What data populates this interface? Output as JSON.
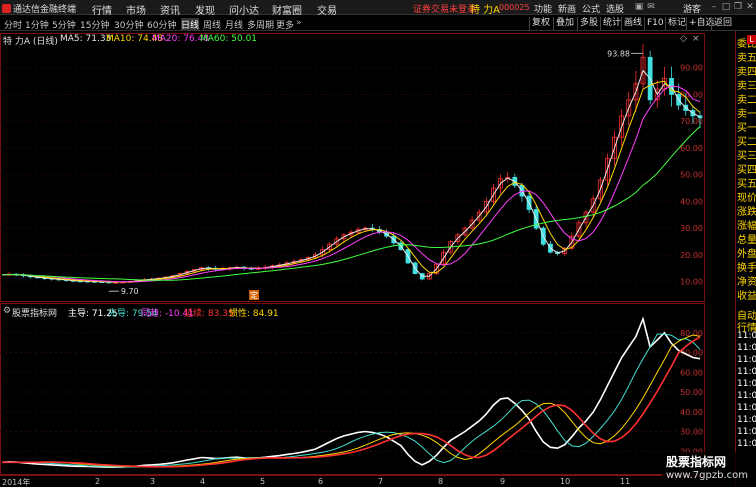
{
  "titlebar": {
    "app_name": "通达信金融终端",
    "menus": [
      "行情",
      "市场",
      "资讯",
      "发现",
      "问小达",
      "财富圈",
      "交易"
    ],
    "not_logged": "证券交易未登录",
    "stock_name": "特 力A",
    "stock_sub": "000025",
    "right_menus": [
      "功能",
      "新画",
      "公式",
      "选股",
      "游客"
    ]
  },
  "toolbar": {
    "periods": [
      "分时",
      "1分钟",
      "5分钟",
      "15分钟",
      "30分钟",
      "60分钟",
      "日线",
      "周线",
      "月线",
      "多周期",
      "更多"
    ],
    "selected_period": "日线",
    "right_buttons": [
      "复权",
      "叠加",
      "多股",
      "统计",
      "画线",
      "F10",
      "标记",
      "+自选",
      "返回"
    ]
  },
  "ma_legend": {
    "title": "特 力A (日线)",
    "items": [
      {
        "label": "MA5: 71.33",
        "color": "#e8e8e8"
      },
      {
        "label": "MA10: 74.48",
        "color": "#ffd700"
      },
      {
        "label": "MA20: 76.48",
        "color": "#ff40ff"
      },
      {
        "label": "MA60: 50.01",
        "color": "#40ff40"
      }
    ]
  },
  "main_chart": {
    "y_ticks": [
      "90.00",
      "80.00",
      "70.00",
      "60.00",
      "50.00",
      "40.00",
      "30.00",
      "20.00",
      "10.00"
    ],
    "high_label": "93.88",
    "low_label": "9.70",
    "marker_label": "定"
  },
  "indicator": {
    "name": "股票指标网",
    "items": [
      {
        "label": "主导: 71.25",
        "color": "#ffffff"
      },
      {
        "label": "先导: 79.54",
        "color": "#40e0d0"
      },
      {
        "label": "同趋: -10.41",
        "color": "#ff40ff"
      },
      {
        "label": "延续: 83.35",
        "color": "#ff3030"
      },
      {
        "label": "惯性: 84.91",
        "color": "#ffd700"
      }
    ],
    "y_ticks": [
      "80.00",
      "70.00",
      "60.00",
      "50.00",
      "40.00",
      "30.00",
      "20.00"
    ]
  },
  "xaxis": {
    "labels": [
      "2014年",
      "2",
      "3",
      "4",
      "5",
      "6",
      "7",
      "8",
      "9",
      "10",
      "11"
    ]
  },
  "right_panel": {
    "items": [
      "委比",
      "卖五",
      "卖四",
      "卖三",
      "卖二",
      "卖一",
      "买一",
      "买二",
      "买三",
      "买四",
      "买五",
      "现价",
      "涨跌",
      "涨幅",
      "总量",
      "外盘",
      "换手",
      "净资",
      "收益"
    ],
    "items2": [
      "自动",
      "行情",
      "11:08",
      "11:08",
      "11:08",
      "11:09",
      "11:09",
      "11:09",
      "11:09",
      "11:09",
      "11:09",
      "11:09"
    ],
    "badge": "L"
  },
  "watermark": {
    "line1": "股票指标网",
    "line2": "www.7gpzb.com"
  },
  "chart_data": {
    "type": "line",
    "title": "特 力A (日线)",
    "x_labels": [
      "2014年",
      "2",
      "3",
      "4",
      "5",
      "6",
      "7",
      "8",
      "9",
      "10",
      "11"
    ],
    "y_range": [
      5,
      100
    ],
    "price_path": [
      12.5,
      12.8,
      12.6,
      12.2,
      11.8,
      11.5,
      11.3,
      11.0,
      10.8,
      10.5,
      10.3,
      10.2,
      10.1,
      10.0,
      9.9,
      9.8,
      9.8,
      9.9,
      10.1,
      10.4,
      10.8,
      11.0,
      11.3,
      11.7,
      12.2,
      13.0,
      13.8,
      14.5,
      15.2,
      15.0,
      14.6,
      14.8,
      15.2,
      15.4,
      15.0,
      14.8,
      15.0,
      15.4,
      15.9,
      16.3,
      17.0,
      17.5,
      18.2,
      19.0,
      20.0,
      22.0,
      24.0,
      26.0,
      27.5,
      28.5,
      29.5,
      30.0,
      29.5,
      28.5,
      27.0,
      24.5,
      22.0,
      17.0,
      13.0,
      11.0,
      13.0,
      16.5,
      21.0,
      25.0,
      27.5,
      30.0,
      33.0,
      36.0,
      40.0,
      45.0,
      48.5,
      49.0,
      46.0,
      42.0,
      37.0,
      30.0,
      24.0,
      21.0,
      20.5,
      22.5,
      27.0,
      32.0,
      36.0,
      41.0,
      48.0,
      56.0,
      64.0,
      72.0,
      78.0,
      84.0,
      93.9,
      78.0,
      82.0,
      86.0,
      80.0,
      76.0,
      74.0,
      72.0,
      71.3
    ],
    "ma_series": [
      {
        "name": "MA5",
        "value": 71.33
      },
      {
        "name": "MA10",
        "value": 74.48
      },
      {
        "name": "MA20",
        "value": 76.48
      },
      {
        "name": "MA60",
        "value": 50.01
      }
    ],
    "indicator_series": [
      {
        "name": "主导",
        "value": 71.25
      },
      {
        "name": "先导",
        "value": 79.54
      },
      {
        "name": "同趋",
        "value": -10.41
      },
      {
        "name": "延续",
        "value": 83.35
      },
      {
        "name": "惯性",
        "value": 84.91
      }
    ],
    "indicator_range": [
      10,
      90
    ]
  }
}
